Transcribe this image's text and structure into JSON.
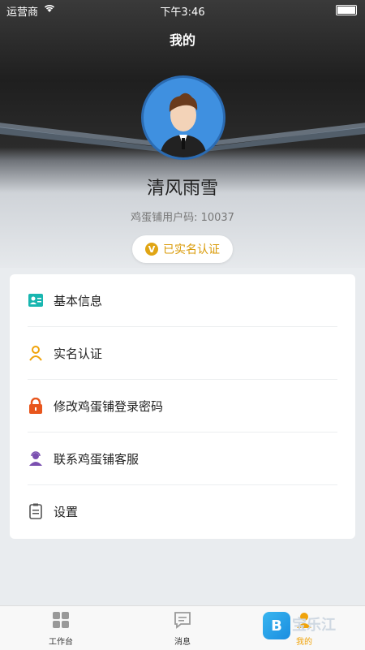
{
  "status": {
    "carrier": "运营商",
    "time": "下午3:46"
  },
  "header": {
    "title": "我的"
  },
  "profile": {
    "name": "清风雨雪",
    "user_code": "鸡蛋铺用户码: 10037",
    "verified_label": "已实名认证",
    "verified_badge_letter": "V"
  },
  "menu": {
    "items": [
      {
        "label": "基本信息",
        "icon": "id-card-icon",
        "color": "#18b6b0"
      },
      {
        "label": "实名认证",
        "icon": "user-outline-icon",
        "color": "#f0a30a"
      },
      {
        "label": "修改鸡蛋铺登录密码",
        "icon": "lock-icon",
        "color": "#e8561d"
      },
      {
        "label": "联系鸡蛋铺客服",
        "icon": "customer-service-icon",
        "color": "#7a4fb0"
      },
      {
        "label": "设置",
        "icon": "settings-doc-icon",
        "color": "#555555"
      }
    ]
  },
  "tabbar": {
    "tabs": [
      {
        "label": "工作台",
        "icon": "grid-icon",
        "active": false
      },
      {
        "label": "消息",
        "icon": "message-icon",
        "active": false
      },
      {
        "label": "我的",
        "icon": "profile-icon",
        "active": true
      }
    ]
  },
  "watermark": {
    "logo_letter": "B",
    "text": "宝乐江"
  },
  "colors": {
    "accent": "#f0a30a",
    "avatar_bg": "#3f90e0"
  }
}
